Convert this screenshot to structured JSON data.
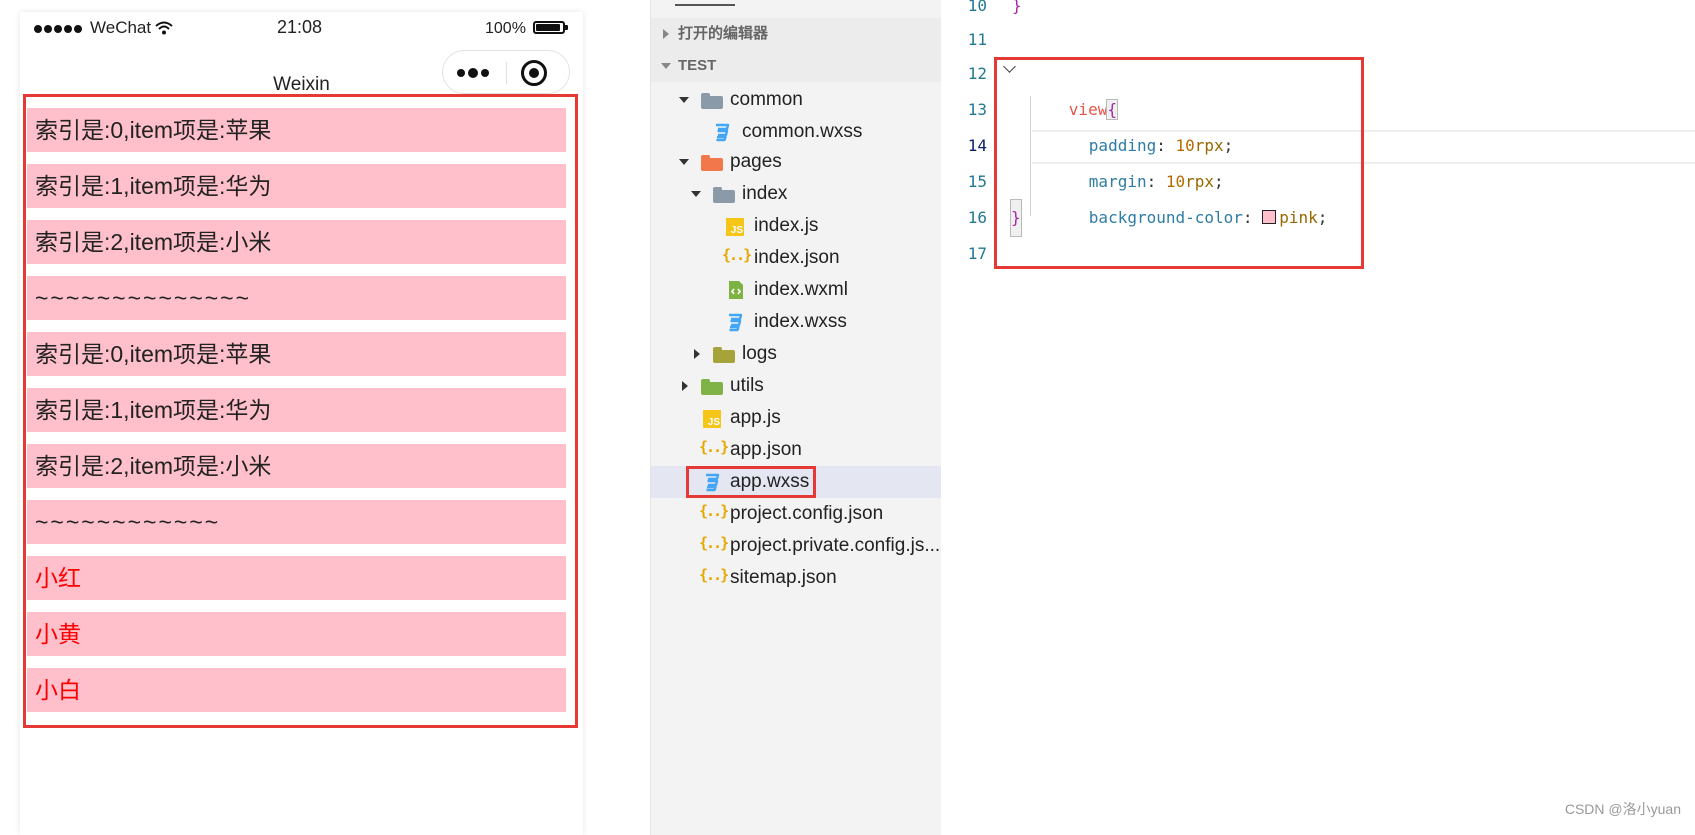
{
  "phone": {
    "status_bar": {
      "carrier": "WeChat",
      "time": "21:08",
      "battery": "100%"
    },
    "nav_title": "Weixin",
    "items": [
      "索引是:0,item项是:苹果",
      "索引是:1,item项是:华为",
      "索引是:2,item项是:小米",
      "~~~~~~~~~~~~~~",
      "索引是:0,item项是:苹果",
      "索引是:1,item项是:华为",
      "索引是:2,item项是:小米",
      "~~~~~~~~~~~~",
      "小红",
      "小黄",
      "小白"
    ],
    "colors": {
      "item_background": "#ffc0cb",
      "highlight_text": "#ff0000",
      "frame": "#e53935"
    }
  },
  "explorer": {
    "open_editors_label": "打开的编辑器",
    "project_label": "TEST",
    "tree": [
      {
        "name": "common",
        "icon": "folder-icon"
      },
      {
        "name": "common.wxss",
        "icon": "css-file-icon"
      },
      {
        "name": "pages",
        "icon": "folder-icon"
      },
      {
        "name": "index",
        "icon": "folder-icon"
      },
      {
        "name": "index.js",
        "icon": "js-file-icon"
      },
      {
        "name": "index.json",
        "icon": "json-file-icon"
      },
      {
        "name": "index.wxml",
        "icon": "wxml-file-icon"
      },
      {
        "name": "index.wxss",
        "icon": "css-file-icon"
      },
      {
        "name": "logs",
        "icon": "folder-icon"
      },
      {
        "name": "utils",
        "icon": "folder-icon"
      },
      {
        "name": "app.js",
        "icon": "js-file-icon"
      },
      {
        "name": "app.json",
        "icon": "json-file-icon"
      },
      {
        "name": "app.wxss",
        "icon": "css-file-icon",
        "selected": true
      },
      {
        "name": "project.config.json",
        "icon": "json-file-icon"
      },
      {
        "name": "project.private.config.js...",
        "icon": "json-file-icon"
      },
      {
        "name": "sitemap.json",
        "icon": "json-file-icon"
      }
    ],
    "js_badge": "JS",
    "json_glyph": "{..}"
  },
  "editor": {
    "line_numbers": [
      "10",
      "11",
      "12",
      "13",
      "14",
      "15",
      "16",
      "17"
    ],
    "code": {
      "l10_brace": "}",
      "l12_selector": "view",
      "l12_brace": "{",
      "l13_prop": "padding",
      "l13_colon": ": ",
      "l13_num": "10",
      "l13_unit": "rpx",
      "l13_semi": ";",
      "l14_prop": "margin",
      "l14_colon": ": ",
      "l14_num": "10",
      "l14_unit": "rpx",
      "l14_semi": ";",
      "l15_prop": "background-color",
      "l15_colon": ": ",
      "l15_value": "pink",
      "l15_semi": ";",
      "l16_brace": "}"
    },
    "active_line": "14"
  },
  "watermark": "CSDN @洛小yuan"
}
